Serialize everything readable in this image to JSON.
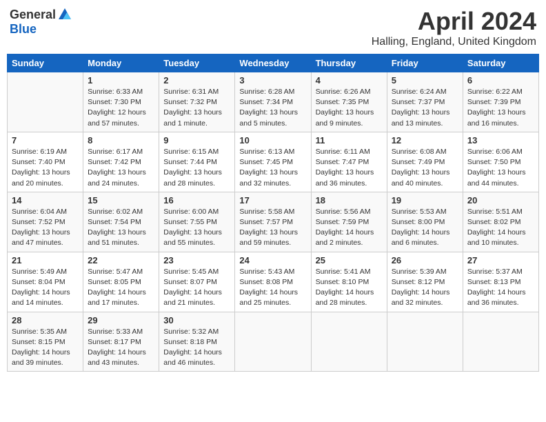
{
  "header": {
    "logo_general": "General",
    "logo_blue": "Blue",
    "title": "April 2024",
    "subtitle": "Halling, England, United Kingdom"
  },
  "days_of_week": [
    "Sunday",
    "Monday",
    "Tuesday",
    "Wednesday",
    "Thursday",
    "Friday",
    "Saturday"
  ],
  "weeks": [
    [
      {
        "day": "",
        "sunrise": "",
        "sunset": "",
        "daylight": ""
      },
      {
        "day": "1",
        "sunrise": "Sunrise: 6:33 AM",
        "sunset": "Sunset: 7:30 PM",
        "daylight": "Daylight: 12 hours and 57 minutes."
      },
      {
        "day": "2",
        "sunrise": "Sunrise: 6:31 AM",
        "sunset": "Sunset: 7:32 PM",
        "daylight": "Daylight: 13 hours and 1 minute."
      },
      {
        "day": "3",
        "sunrise": "Sunrise: 6:28 AM",
        "sunset": "Sunset: 7:34 PM",
        "daylight": "Daylight: 13 hours and 5 minutes."
      },
      {
        "day": "4",
        "sunrise": "Sunrise: 6:26 AM",
        "sunset": "Sunset: 7:35 PM",
        "daylight": "Daylight: 13 hours and 9 minutes."
      },
      {
        "day": "5",
        "sunrise": "Sunrise: 6:24 AM",
        "sunset": "Sunset: 7:37 PM",
        "daylight": "Daylight: 13 hours and 13 minutes."
      },
      {
        "day": "6",
        "sunrise": "Sunrise: 6:22 AM",
        "sunset": "Sunset: 7:39 PM",
        "daylight": "Daylight: 13 hours and 16 minutes."
      }
    ],
    [
      {
        "day": "7",
        "sunrise": "Sunrise: 6:19 AM",
        "sunset": "Sunset: 7:40 PM",
        "daylight": "Daylight: 13 hours and 20 minutes."
      },
      {
        "day": "8",
        "sunrise": "Sunrise: 6:17 AM",
        "sunset": "Sunset: 7:42 PM",
        "daylight": "Daylight: 13 hours and 24 minutes."
      },
      {
        "day": "9",
        "sunrise": "Sunrise: 6:15 AM",
        "sunset": "Sunset: 7:44 PM",
        "daylight": "Daylight: 13 hours and 28 minutes."
      },
      {
        "day": "10",
        "sunrise": "Sunrise: 6:13 AM",
        "sunset": "Sunset: 7:45 PM",
        "daylight": "Daylight: 13 hours and 32 minutes."
      },
      {
        "day": "11",
        "sunrise": "Sunrise: 6:11 AM",
        "sunset": "Sunset: 7:47 PM",
        "daylight": "Daylight: 13 hours and 36 minutes."
      },
      {
        "day": "12",
        "sunrise": "Sunrise: 6:08 AM",
        "sunset": "Sunset: 7:49 PM",
        "daylight": "Daylight: 13 hours and 40 minutes."
      },
      {
        "day": "13",
        "sunrise": "Sunrise: 6:06 AM",
        "sunset": "Sunset: 7:50 PM",
        "daylight": "Daylight: 13 hours and 44 minutes."
      }
    ],
    [
      {
        "day": "14",
        "sunrise": "Sunrise: 6:04 AM",
        "sunset": "Sunset: 7:52 PM",
        "daylight": "Daylight: 13 hours and 47 minutes."
      },
      {
        "day": "15",
        "sunrise": "Sunrise: 6:02 AM",
        "sunset": "Sunset: 7:54 PM",
        "daylight": "Daylight: 13 hours and 51 minutes."
      },
      {
        "day": "16",
        "sunrise": "Sunrise: 6:00 AM",
        "sunset": "Sunset: 7:55 PM",
        "daylight": "Daylight: 13 hours and 55 minutes."
      },
      {
        "day": "17",
        "sunrise": "Sunrise: 5:58 AM",
        "sunset": "Sunset: 7:57 PM",
        "daylight": "Daylight: 13 hours and 59 minutes."
      },
      {
        "day": "18",
        "sunrise": "Sunrise: 5:56 AM",
        "sunset": "Sunset: 7:59 PM",
        "daylight": "Daylight: 14 hours and 2 minutes."
      },
      {
        "day": "19",
        "sunrise": "Sunrise: 5:53 AM",
        "sunset": "Sunset: 8:00 PM",
        "daylight": "Daylight: 14 hours and 6 minutes."
      },
      {
        "day": "20",
        "sunrise": "Sunrise: 5:51 AM",
        "sunset": "Sunset: 8:02 PM",
        "daylight": "Daylight: 14 hours and 10 minutes."
      }
    ],
    [
      {
        "day": "21",
        "sunrise": "Sunrise: 5:49 AM",
        "sunset": "Sunset: 8:04 PM",
        "daylight": "Daylight: 14 hours and 14 minutes."
      },
      {
        "day": "22",
        "sunrise": "Sunrise: 5:47 AM",
        "sunset": "Sunset: 8:05 PM",
        "daylight": "Daylight: 14 hours and 17 minutes."
      },
      {
        "day": "23",
        "sunrise": "Sunrise: 5:45 AM",
        "sunset": "Sunset: 8:07 PM",
        "daylight": "Daylight: 14 hours and 21 minutes."
      },
      {
        "day": "24",
        "sunrise": "Sunrise: 5:43 AM",
        "sunset": "Sunset: 8:08 PM",
        "daylight": "Daylight: 14 hours and 25 minutes."
      },
      {
        "day": "25",
        "sunrise": "Sunrise: 5:41 AM",
        "sunset": "Sunset: 8:10 PM",
        "daylight": "Daylight: 14 hours and 28 minutes."
      },
      {
        "day": "26",
        "sunrise": "Sunrise: 5:39 AM",
        "sunset": "Sunset: 8:12 PM",
        "daylight": "Daylight: 14 hours and 32 minutes."
      },
      {
        "day": "27",
        "sunrise": "Sunrise: 5:37 AM",
        "sunset": "Sunset: 8:13 PM",
        "daylight": "Daylight: 14 hours and 36 minutes."
      }
    ],
    [
      {
        "day": "28",
        "sunrise": "Sunrise: 5:35 AM",
        "sunset": "Sunset: 8:15 PM",
        "daylight": "Daylight: 14 hours and 39 minutes."
      },
      {
        "day": "29",
        "sunrise": "Sunrise: 5:33 AM",
        "sunset": "Sunset: 8:17 PM",
        "daylight": "Daylight: 14 hours and 43 minutes."
      },
      {
        "day": "30",
        "sunrise": "Sunrise: 5:32 AM",
        "sunset": "Sunset: 8:18 PM",
        "daylight": "Daylight: 14 hours and 46 minutes."
      },
      {
        "day": "",
        "sunrise": "",
        "sunset": "",
        "daylight": ""
      },
      {
        "day": "",
        "sunrise": "",
        "sunset": "",
        "daylight": ""
      },
      {
        "day": "",
        "sunrise": "",
        "sunset": "",
        "daylight": ""
      },
      {
        "day": "",
        "sunrise": "",
        "sunset": "",
        "daylight": ""
      }
    ]
  ]
}
